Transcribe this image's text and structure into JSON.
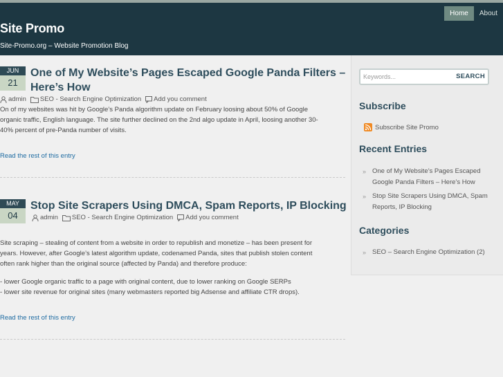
{
  "header": {
    "site_title": "Site Promo",
    "description": "Site-Promo.org – Website Promotion Blog",
    "nav": [
      {
        "label": "Home",
        "active": true
      },
      {
        "label": "About",
        "active": false
      }
    ]
  },
  "posts": [
    {
      "month": "JUN",
      "day": "21",
      "title_line1": "One of My Website’s Pages Escaped Google Panda Filters –",
      "title_line2": "Here’s How",
      "author": "admin",
      "category": "SEO - Search Engine Optimization",
      "comments": "Add you comment",
      "paragraph1_l1": "On of my websites was hit by Google’s Panda algorithm update on February loosing about 50% of Google",
      "paragraph1_l2": "organic traffic, English language. The site further declined on the 2nd algo update in April, loosing another 30-",
      "paragraph1_l3": "40% percent of pre-Panda number of visits.",
      "read_more": "Read the rest of this entry"
    },
    {
      "month": "MAY",
      "day": "04",
      "title_line1": "Stop Site Scrapers Using DMCA, Spam Reports, IP Blocking",
      "author": "admin",
      "category": "SEO - Search Engine Optimization",
      "comments": "Add you comment",
      "paragraph1_l1": "Site scraping – stealing of content from a website in order to republish and monetize – has been present for",
      "paragraph1_l2": "years. However, after Google’s latest algorithm update, codenamed Panda, sites that publish stolen content",
      "paragraph1_l3": "often rank higher than the original source (affected by Panda) and therefore produce:",
      "bullet1": "- lower Google organic traffic to a page with original content, due to lower ranking on Google SERPs",
      "bullet2": "- lower site revenue for original sites (many webmasters reported big Adsense and affiliate CTR drops).",
      "read_more": "Read the rest of this entry"
    }
  ],
  "sidebar": {
    "search_placeholder": "Keywords...",
    "search_button": "SEARCH",
    "subscribe_heading": "Subscribe",
    "subscribe_link": "Subscribe Site Promo",
    "recent_heading": "Recent Entries",
    "recent": [
      {
        "l1": "One of My Website’s Pages Escaped",
        "l2": "Google Panda Filters – Here’s How"
      },
      {
        "l1": "Stop Site Scrapers Using DMCA, Spam",
        "l2": "Reports, IP Blocking"
      }
    ],
    "categories_heading": "Categories",
    "categories": [
      {
        "name": "SEO – Search Engine Optimization",
        "count": "(2)"
      }
    ]
  },
  "colors": {
    "header_bg": "#1d3742",
    "accent": "#2e4d5c",
    "link": "#1c6aa1"
  }
}
